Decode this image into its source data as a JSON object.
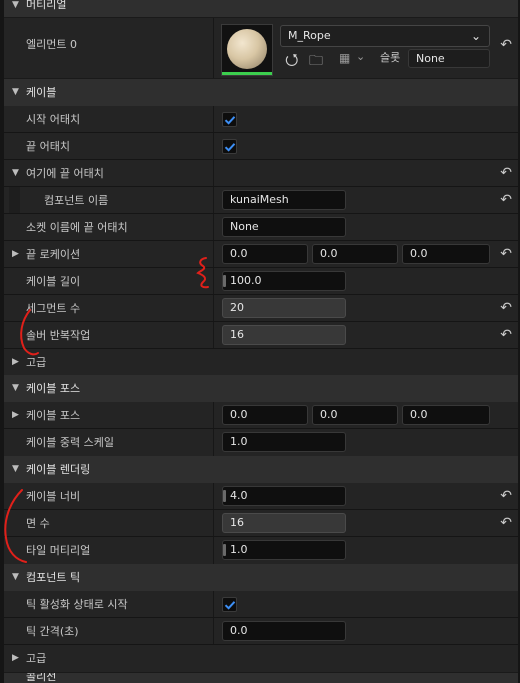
{
  "sections": {
    "material": "머티리얼",
    "cable": "케이블",
    "cable_force": "케이블 포스",
    "cable_rendering": "케이블 렌더링",
    "component_tick": "컴포넌트 틱",
    "collision": "콜리전"
  },
  "material": {
    "element_label": "엘리먼트 0",
    "material_name": "M_Rope",
    "slot_label": "슬롯",
    "slot_value": "None"
  },
  "cable": {
    "attach_start_label": "시작 어태치",
    "attach_start": true,
    "attach_end_label": "끝 어태치",
    "attach_end": true,
    "attach_end_to_label": "여기에 끝 어태치",
    "component_name_label": "컴포넌트 이름",
    "component_name_value": "kunaiMesh",
    "socket_name_label": "소켓 이름에 끝 어태치",
    "socket_name_value": "None",
    "end_location_label": "끝 로케이션",
    "end_location": [
      "0.0",
      "0.0",
      "0.0"
    ],
    "cable_length_label": "케이블 길이",
    "cable_length": "100.0",
    "num_segments_label": "세그먼트 수",
    "num_segments": "20",
    "solver_iterations_label": "솔버 반복작업",
    "solver_iterations": "16",
    "advanced_label": "고급"
  },
  "cable_force": {
    "force_label": "케이블 포스",
    "force": [
      "0.0",
      "0.0",
      "0.0"
    ],
    "gravity_scale_label": "케이블 중력 스케일",
    "gravity_scale": "1.0"
  },
  "rendering": {
    "width_label": "케이블 너비",
    "width": "4.0",
    "num_sides_label": "면 수",
    "num_sides": "16",
    "tile_material_label": "타일 머티리얼",
    "tile_material": "1.0"
  },
  "tick": {
    "start_enabled_label": "틱 활성화 상태로 시작",
    "start_enabled": true,
    "interval_label": "틱 간격(초)",
    "interval": "0.0",
    "advanced_label": "고급"
  },
  "colors": {
    "accent_blue": "#3d8ff5",
    "annotation_red": "#e0201a",
    "material_bar": "#3ccf4e"
  },
  "icons": {
    "expand_open": "triangle-down-icon",
    "expand_closed": "triangle-right-icon",
    "reset": "reset-arrow-icon",
    "browse": "browse-arrow-icon",
    "folder": "folder-search-icon",
    "checker": "checker-icon",
    "dropdown": "chevron-down-icon"
  }
}
